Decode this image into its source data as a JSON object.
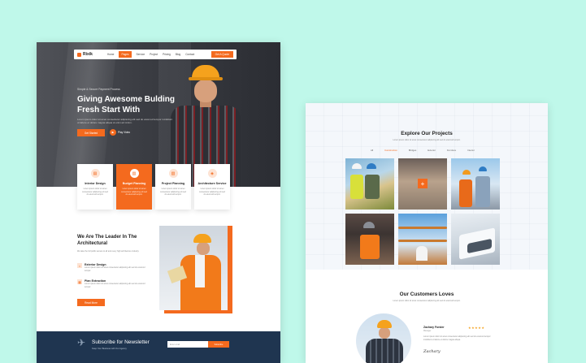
{
  "left": {
    "nav": {
      "logo": "Rixik",
      "items": [
        "Home",
        "Pages",
        "Service",
        "Project",
        "Pricing",
        "Blog",
        "Contact"
      ],
      "active_index": 1,
      "cta": "Get A Quote"
    },
    "hero": {
      "kicker": "Simple & Secure Payment Process",
      "title": "Giving Awesome Bulding Fresh Start With",
      "description": "Lorem ipsum dolor sit amet consectetur adipiscing elit sed do eiusmod tempor incididunt ut labore et dolore magna aliqua ut enim ad minim.",
      "button": "Get Started",
      "play_label": "Play Video"
    },
    "services": [
      {
        "title": "Interior Design",
        "description": "Lorem ipsum dolor sit amet consectetur adipiscing elit sed do eiusmod tempor.",
        "icon": "building-icon",
        "active": false
      },
      {
        "title": "Budget Planning",
        "description": "Lorem ipsum dolor sit amet consectetur adipiscing elit sed do eiusmod tempor.",
        "icon": "chart-icon",
        "active": true
      },
      {
        "title": "Project Planning",
        "description": "Lorem ipsum dolor sit amet consectetur adipiscing elit sed do eiusmod tempor.",
        "icon": "clipboard-icon",
        "active": false
      },
      {
        "title": "Architecture Service",
        "description": "Lorem ipsum dolor sit amet consectetur adipiscing elit sed do eiusmod tempor.",
        "icon": "compass-icon",
        "active": false
      }
    ],
    "about": {
      "title": "We Are The Leader In The Architectural",
      "description": "We take the full public access to all and every high architecture industry.",
      "features": [
        {
          "title": "Exterior Design",
          "description": "Lorem ipsum dolor sit amet consectetur adipiscing elit sed do eiusmod tempor."
        },
        {
          "title": "Plan Extraction",
          "description": "Lorem ipsum dolor sit amet consectetur adipiscing elit sed do eiusmod tempor."
        }
      ],
      "button": "Read More"
    },
    "newsletter": {
      "title": "Subscribe for Newsletter",
      "subtitle": "Keep Your Business with Our Agency",
      "placeholder": "Enter email",
      "button": "Subscribe"
    }
  },
  "right": {
    "projects": {
      "title": "Explore Our Projects",
      "description": "Lorem ipsum dolor sit amet consectetur adipiscing elit sed do eiusmod tempor.",
      "filters": [
        "All",
        "Construction",
        "Bridges",
        "Exterior",
        "Furniture",
        "Interior"
      ],
      "active_filter": 1
    },
    "customers": {
      "title": "Our Customers Loves",
      "description": "Lorem ipsum dolor sit amet consectetur adipiscing elit sed do eiusmod tempor.",
      "review": {
        "name": "Zachary Forster",
        "role": "Manager",
        "stars": "★★★★★",
        "text": "Lorem ipsum dolor sit amet consectetur adipiscing elit sed do eiusmod tempor incididunt ut labore et dolore magna aliqua.",
        "signature": "Zachary"
      }
    }
  },
  "colors": {
    "accent": "#f46a1e",
    "background": "#bff8ea",
    "navy": "#1f3550"
  }
}
